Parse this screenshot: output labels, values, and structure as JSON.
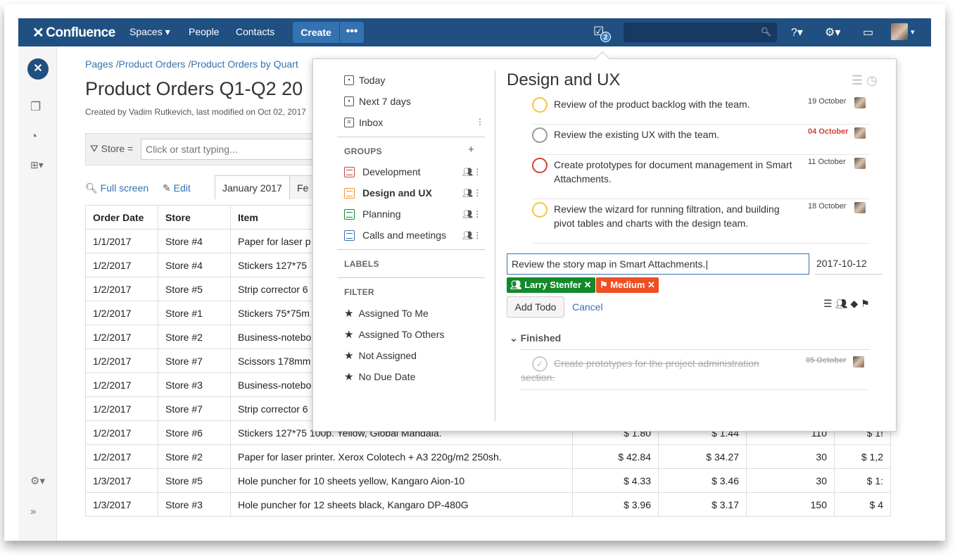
{
  "topbar": {
    "logo_text": "Confluence",
    "nav": [
      "Spaces ▾",
      "People",
      "Contacts"
    ],
    "create_label": "Create",
    "more_label": "•••",
    "tasks_badge": "2",
    "search_placeholder": "",
    "help_label": "?▾",
    "settings_label": "⚙▾",
    "notifications_label": "▭",
    "profile_caret": "▾"
  },
  "sidebar": {
    "icons": [
      "pages-icon",
      "feed-icon",
      "tree-icon",
      "settings-icon",
      "collapse-icon"
    ]
  },
  "page": {
    "breadcrumb": [
      "Pages",
      "Product Orders",
      "Product Orders by Quart"
    ],
    "title": "Product Orders Q1-Q2 20",
    "byline": "Created by Vadim Rutkevich, last modified on Oct 02, 2017",
    "filter_label": "Store =",
    "filter_placeholder": "Click or start typing...",
    "full_screen": "Full screen",
    "edit": "Edit",
    "tabs": [
      "January 2017",
      "Fe"
    ]
  },
  "table": {
    "headers": [
      "Order Date",
      "Store",
      "Item",
      "",
      "",
      "",
      ""
    ],
    "rows": [
      [
        "1/1/2017",
        "Store #4",
        "Paper for laser p",
        "",
        "",
        "",
        ""
      ],
      [
        "1/2/2017",
        "Store #4",
        "Stickers 127*75",
        "",
        "",
        "",
        ""
      ],
      [
        "1/2/2017",
        "Store #5",
        "Strip corrector 6",
        "",
        "",
        "",
        ""
      ],
      [
        "1/2/2017",
        "Store #1",
        "Stickers 75*75m",
        "",
        "",
        "",
        ""
      ],
      [
        "1/2/2017",
        "Store #2",
        "Business-notebo",
        "",
        "",
        "",
        ""
      ],
      [
        "1/2/2017",
        "Store #7",
        "Scissors 178mm",
        "",
        "",
        "",
        ""
      ],
      [
        "1/2/2017",
        "Store #3",
        "Business-notebo",
        "",
        "",
        "",
        ""
      ],
      [
        "1/2/2017",
        "Store #7",
        "Strip corrector 6",
        "",
        "",
        "",
        ""
      ],
      [
        "1/2/2017",
        "Store #6",
        "Stickers 127*75 100p. Yellow, Global Mandala.",
        "$ 1.80",
        "$ 1.44",
        "110",
        "$ 1!"
      ],
      [
        "1/2/2017",
        "Store #2",
        "Paper for laser printer. Xerox Colotech + A3 220g/m2 250sh.",
        "$ 42.84",
        "$ 34.27",
        "30",
        "$ 1,2"
      ],
      [
        "1/3/2017",
        "Store #5",
        "Hole puncher for 10 sheets yellow, Kangaro Aion-10",
        "$ 4.33",
        "$ 3.46",
        "30",
        "$ 1:"
      ],
      [
        "1/3/2017",
        "Store #3",
        "Hole puncher for 12 sheets black, Kangaro DP-480G",
        "$ 3.96",
        "$ 3.17",
        "150",
        "$ 4"
      ]
    ]
  },
  "popup": {
    "nav": {
      "today": "Today",
      "next7": "Next 7 days",
      "inbox": "Inbox",
      "groups_head": "GROUPS",
      "groups": [
        {
          "label": "Development",
          "color": "#d04437"
        },
        {
          "label": "Design and UX",
          "color": "#f79232"
        },
        {
          "label": "Planning",
          "color": "#14892c"
        },
        {
          "label": "Calls and meetings",
          "color": "#3572b0"
        }
      ],
      "labels_head": "LABELS",
      "filter_head": "FILTER",
      "filters": [
        "Assigned To Me",
        "Assigned To Others",
        "Not Assigned",
        "No Due Date"
      ]
    },
    "detail": {
      "title": "Design and UX",
      "tasks": [
        {
          "text": "Review of the product backlog with the team.",
          "due": "19 October",
          "color": "#f6c342",
          "overdue": false
        },
        {
          "text": "Review the existing UX with the team.",
          "due": "04 October",
          "color": "#999999",
          "overdue": true
        },
        {
          "text": "Create prototypes for document management in Smart Attachments.",
          "due": "11 October",
          "color": "#d04437",
          "overdue": false
        },
        {
          "text": "Review the wizard for running filtration, and building pivot tables and charts with the design team.",
          "due": "18 October",
          "color": "#f6c342",
          "overdue": false
        }
      ],
      "input_value": "Review the story map in Smart Attachments.",
      "date_value": "2017-10-12",
      "assignee_tag": "Larry Stenfer ✕",
      "priority_tag": "Medium ✕",
      "add_todo": "Add Todo",
      "cancel": "Cancel",
      "finished_head": "⌄ Finished",
      "finished_task": {
        "text": "Create prototypes for the project administration section.",
        "due": "05 October"
      }
    }
  },
  "colors": {
    "brand": "#205081",
    "link": "#3572b0",
    "assignee": "#14892c",
    "priority": "#f04e23"
  }
}
